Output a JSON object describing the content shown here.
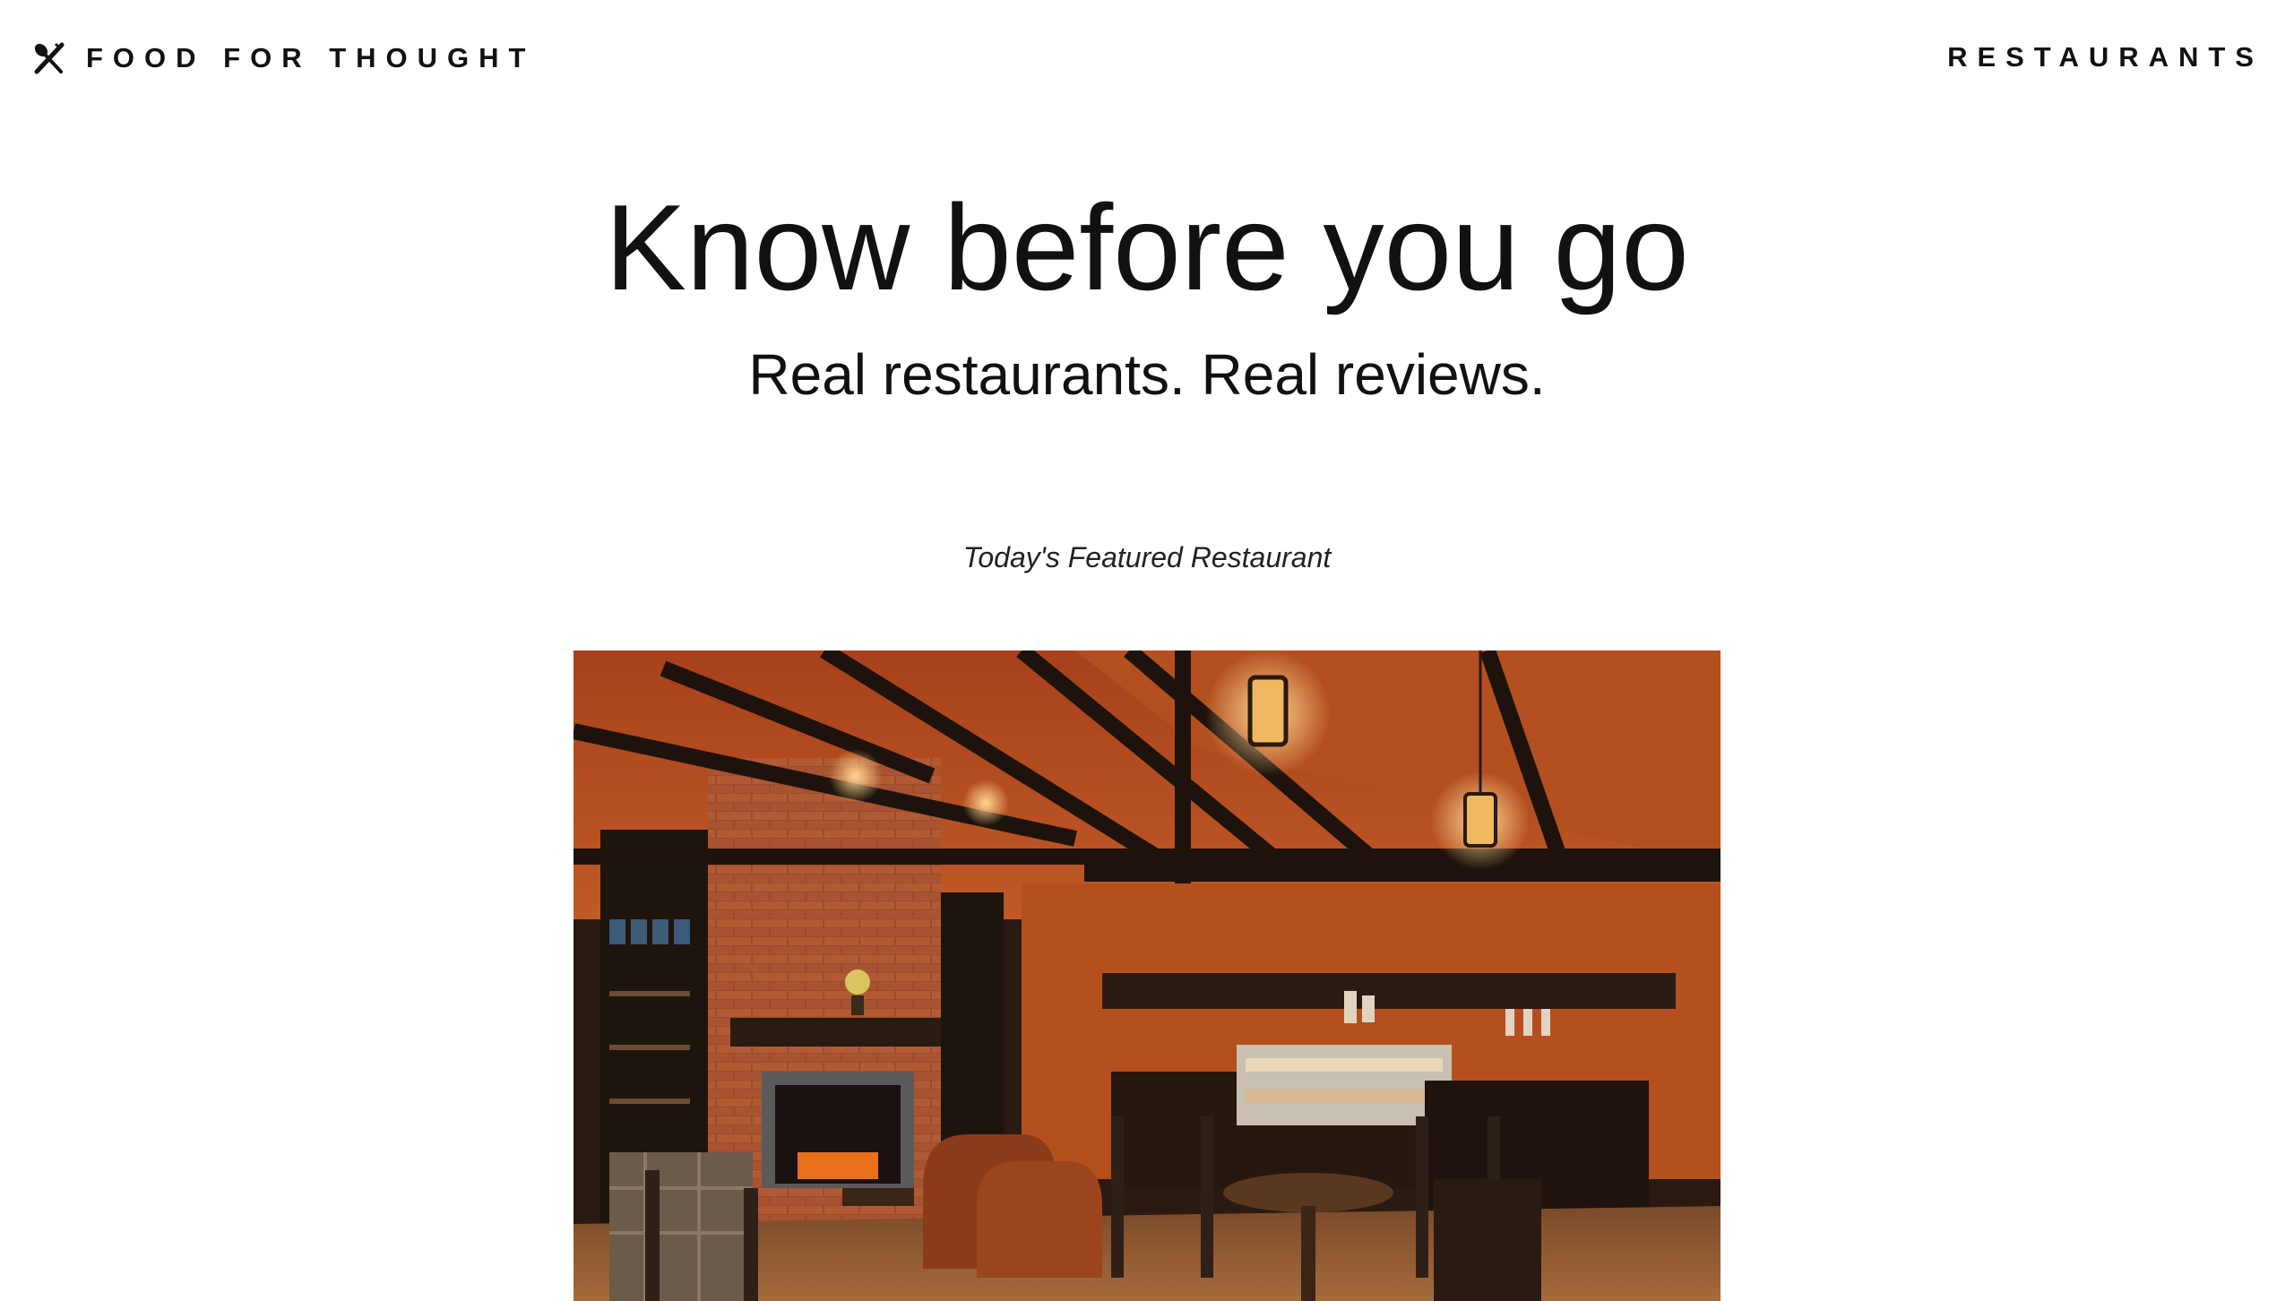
{
  "nav": {
    "brand_icon": "fork-spoon-icon",
    "brand_name": "FOOD FOR THOUGHT",
    "links": [
      "RESTAURANTS"
    ]
  },
  "hero": {
    "title": "Know before you go",
    "subtitle": "Real restaurants. Real reviews."
  },
  "featured": {
    "label": "Today's Featured Restaurant",
    "image": "restaurant-interior-photo"
  },
  "colors": {
    "text": "#111111",
    "background": "#ffffff",
    "photo_wall": "#b5501e",
    "photo_brick": "#9a4a2c",
    "photo_beam": "#2a1a12"
  }
}
